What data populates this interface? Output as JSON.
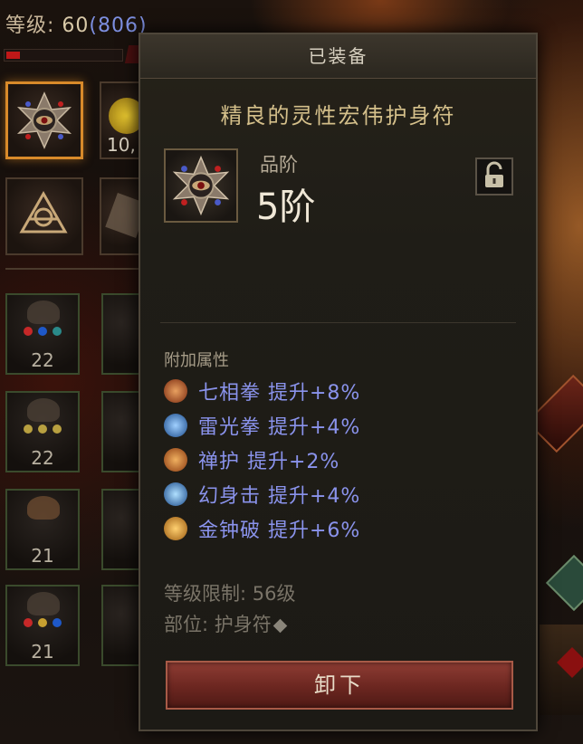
{
  "character": {
    "level_label": "等级: ",
    "level": "60",
    "paragon": "(806)",
    "exp_fraction": 0.12
  },
  "inventory": {
    "partial_value": "10,",
    "gem_slots": [
      {
        "rank": "22",
        "gem_colors": [
          "#c62828",
          "#1e58c8",
          "#2a8a8a"
        ]
      },
      {
        "rank": "22",
        "gem_colors": [
          "#b8a040",
          "#b8a040",
          "#b8a040"
        ]
      },
      {
        "rank": "21",
        "gem_colors": []
      },
      {
        "rank": "21",
        "gem_colors": [
          "#c62828",
          "#c8a030",
          "#1e58c8"
        ]
      }
    ]
  },
  "tooltip": {
    "header": "已装备",
    "item_name": "精良的灵性宏伟护身符",
    "tier_label": "品阶",
    "tier_value": "5阶",
    "affix_header": "附加属性",
    "affixes": [
      {
        "text": "七相拳  提升+8%",
        "icon": "seven-sided-strike-icon",
        "color": "#c0561e"
      },
      {
        "text": "雷光拳  提升+4%",
        "icon": "lightning-fist-icon",
        "color": "#3a7ac8"
      },
      {
        "text": "禅护  提升+2%",
        "icon": "zen-shield-icon",
        "color": "#c0561e"
      },
      {
        "text": "幻身击  提升+4%",
        "icon": "phantom-strike-icon",
        "color": "#3a7ac8"
      },
      {
        "text": "金钟破  提升+6%",
        "icon": "golden-bell-icon",
        "color": "#c88a1e"
      }
    ],
    "required_level": "等级限制: 56级",
    "slot": "部位: 护身符",
    "unequip_label": "卸下"
  }
}
